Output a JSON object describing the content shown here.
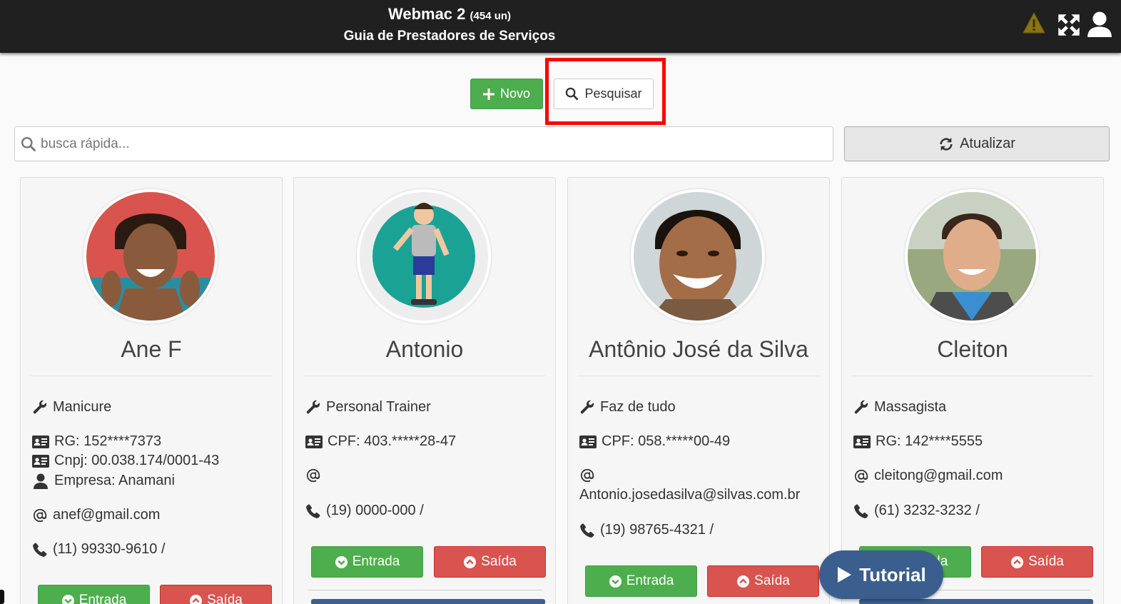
{
  "header": {
    "app_name": "Webmac 2",
    "count": "(454 un)",
    "subtitle": "Guia de Prestadores de Serviços"
  },
  "toolbar": {
    "new_label": "Novo",
    "search_label": "Pesquisar",
    "refresh_label": "Atualizar"
  },
  "search": {
    "placeholder": "busca rápida..."
  },
  "cards": [
    {
      "name": "Ane F",
      "service": "Manicure",
      "doc1": "RG: 152****7373",
      "doc2": "Cnpj: 00.038.174/0001-43",
      "company": "Empresa: Anamani",
      "email": "anef@gmail.com",
      "phone": "(11) 99330-9610 /",
      "entrada": "Entrada",
      "saida": "Saída"
    },
    {
      "name": "Antonio",
      "service": "Personal Trainer",
      "doc1": "CPF: 403.*****28-47",
      "email": "",
      "phone": "(19) 0000-000 /",
      "entrada": "Entrada",
      "saida": "Saída"
    },
    {
      "name": "Antônio José da Silva",
      "service": "Faz de tudo",
      "doc1": "CPF: 058.*****00-49",
      "email": "Antonio.josedasilva@silvas.com.br",
      "phone": "(19) 98765-4321 /",
      "entrada": "Entrada",
      "saida": "Saída"
    },
    {
      "name": "Cleiton",
      "service": "Massagista",
      "doc1": "RG: 142****5555",
      "email": "cleitong@gmail.com",
      "phone": "(61) 3232-3232 /",
      "entrada": "Entrada",
      "saida": "Saída"
    }
  ],
  "tutorial": {
    "label": "Tutorial"
  },
  "colors": {
    "topbar": "#202020",
    "green": "#4cae4c",
    "red": "#d9534f",
    "highlight": "#ff0000",
    "tutorial": "#3a5f8e"
  }
}
